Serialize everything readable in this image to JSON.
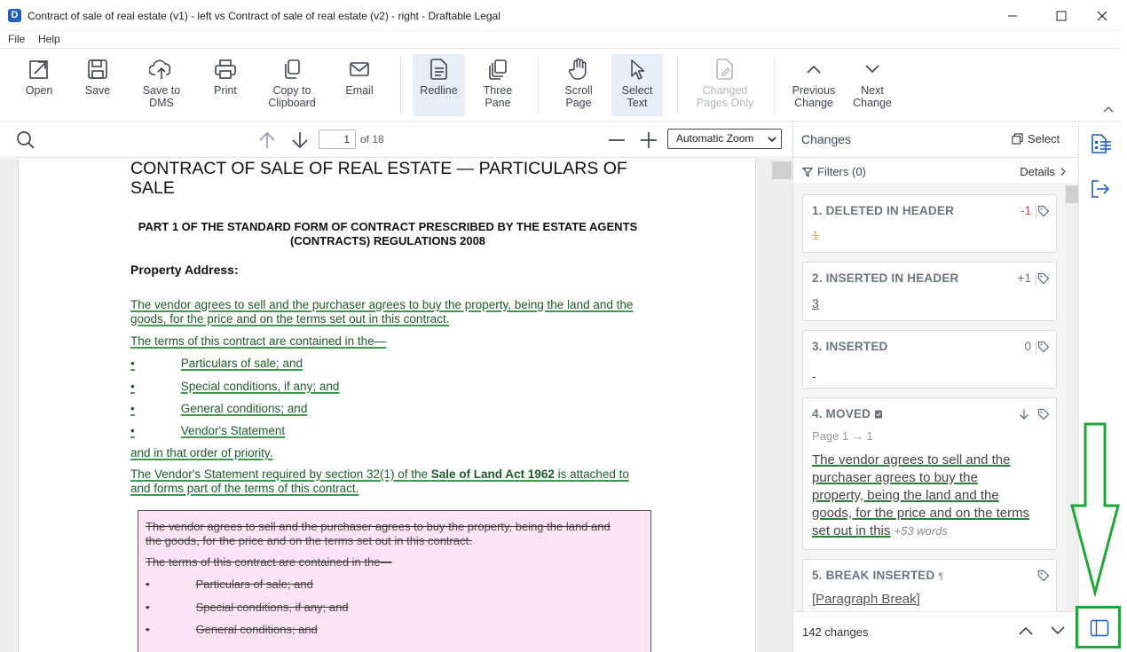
{
  "window": {
    "title": "Contract of sale of real estate (v1) - left vs Contract of sale of real estate (v2) - right - Draftable Legal",
    "app_icon": "draftable-icon"
  },
  "menu": {
    "file": "File",
    "help": "Help"
  },
  "toolbar": {
    "open": "Open",
    "save": "Save",
    "save_to_dms": "Save to\nDMS",
    "print": "Print",
    "copy_to_clipboard": "Copy to\nClipboard",
    "email": "Email",
    "redline": "Redline",
    "three_pane": "Three\nPane",
    "scroll_page": "Scroll\nPage",
    "select_text": "Select\nText",
    "changed_pages_only": "Changed\nPages Only",
    "previous_change": "Previous\nChange",
    "next_change": "Next\nChange"
  },
  "docbar": {
    "page_current": "1",
    "page_total": "of 18",
    "zoom": "Automatic Zoom"
  },
  "document": {
    "title": "CONTRACT OF SALE OF REAL ESTATE — PARTICULARS OF SALE",
    "part_title": "PART 1 OF THE STANDARD FORM OF CONTRACT PRESCRIBED BY THE ESTATE AGENTS (CONTRACTS) REGULATIONS 2008",
    "property_address": "Property Address:",
    "inserted": {
      "line1": "The vendor agrees to sell and the purchaser agrees to buy the property, being the land and the",
      "line2": "goods, for the price and on the terms set out in this contract.",
      "line3": "The terms of this contract are contained in the—",
      "bullet_char": "•",
      "b1": "Particulars of sale; and",
      "b2": "Special conditions, if any; and",
      "b3": "General conditions; and",
      "b4": "Vendor's Statement",
      "line4": "and in that order of priority.",
      "line5a": "The Vendor's Statement required by section 32(1) of the ",
      "line5b": "Sale of Land Act 1962",
      "line5c": " is attached to",
      "line6": "and forms part of the terms of this contract."
    },
    "deleted": {
      "line1": "The vendor agrees to sell and the purchaser agrees to buy the property, being the land and",
      "line2": "the goods, for the price and on the terms set out in this contract.",
      "line3": "The terms of this contract are contained in the—",
      "b1": "Particulars of sale; and",
      "b2": "Special conditions, if any; and",
      "b3": "General conditions; and"
    }
  },
  "changes": {
    "title": "Changes",
    "select": "Select",
    "filters": "Filters (0)",
    "details": "Details",
    "items": [
      {
        "title": "1. DELETED IN HEADER",
        "count": "-1",
        "body": "1"
      },
      {
        "title": "2. INSERTED IN HEADER",
        "count": "+1",
        "body": "3"
      },
      {
        "title": "3. INSERTED",
        "count": "0",
        "body": "-"
      },
      {
        "title": "4. MOVED",
        "page_ref": "Page 1 → 1",
        "l1": "The vendor agrees to sell and the",
        "l2": "purchaser agrees to buy the",
        "l3": "property, being the land and the",
        "l4": "goods, for the price and on the terms",
        "l5": "set out in this",
        "more": "+53 words"
      },
      {
        "title": "5. BREAK INSERTED",
        "body": "[Paragraph Break]"
      }
    ],
    "total": "142 changes"
  },
  "colors": {
    "inserted_text": "#1f5a2a",
    "inserted_underline": "#3f9a4f",
    "deleted_bg": "#fde3f3",
    "annotation": "#22a63a",
    "accent": "#1f5fbf"
  }
}
